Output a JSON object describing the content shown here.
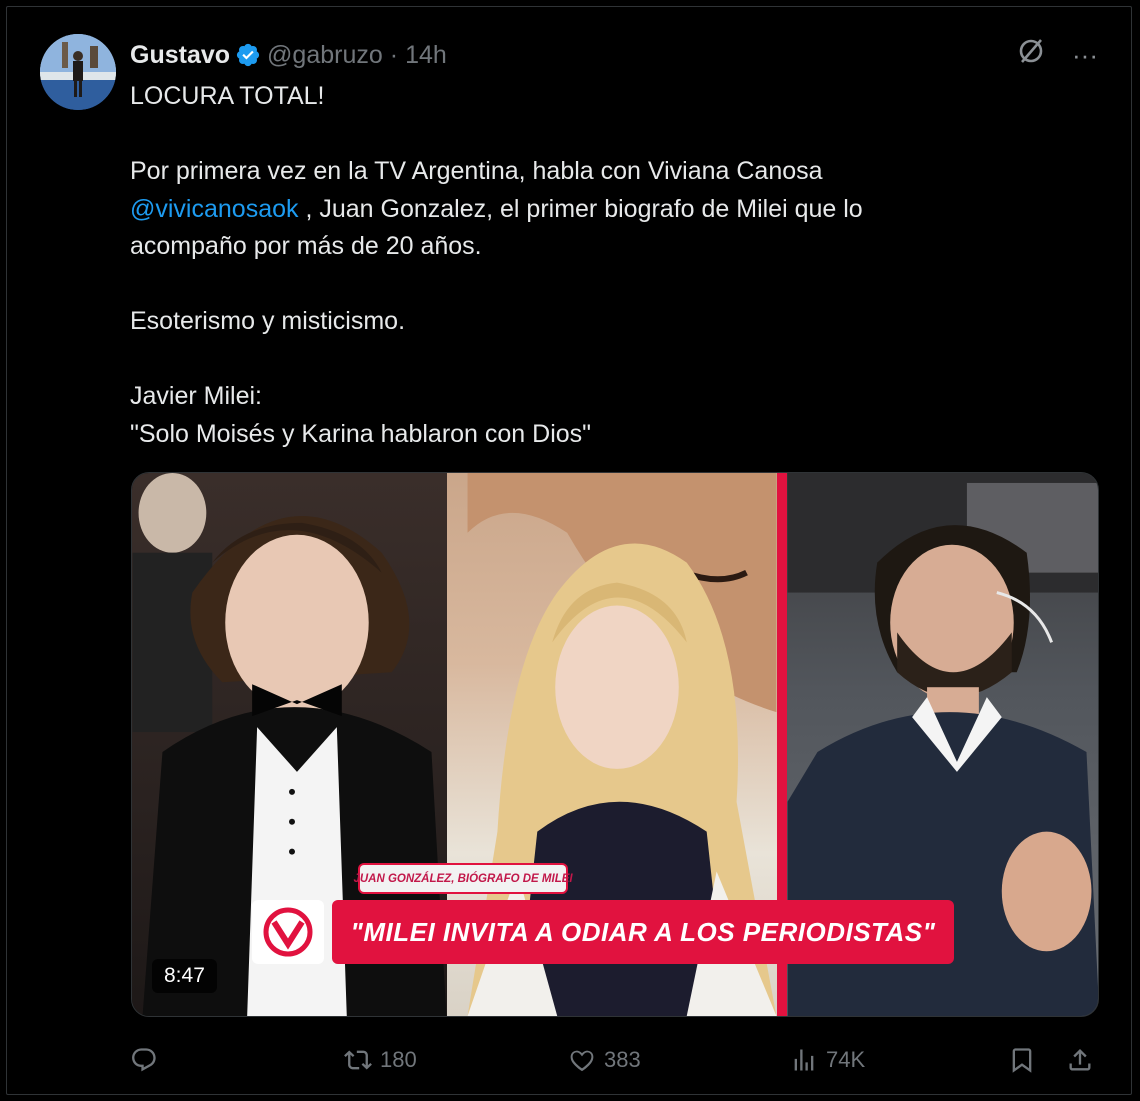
{
  "tweet": {
    "author_name": "Gustavo",
    "handle": "@gabruzo",
    "separator": "·",
    "time": "14h",
    "text_lines": [
      "LOCURA TOTAL!",
      "",
      "Por primera vez en la TV Argentina, habla con Viviana Canosa",
      "@vivicanosaok",
      " , Juan Gonzalez, el primer  biografo de Milei que lo",
      "acompaño por más de 20 años.",
      "",
      "Esoterismo y misticismo.",
      "",
      "Javier Milei:",
      "\"Solo Moisés y Karina hablaron con Dios\""
    ]
  },
  "top_icons": {
    "grok": "grok-icon",
    "more": "···"
  },
  "media": {
    "caption_tag": "JUAN GONZÁLEZ, BIÓGRAFO DE MILEI",
    "headline": "\"MILEI INVITA A ODIAR A LOS PERIODISTAS\"",
    "duration": "8:47"
  },
  "actions": {
    "reply_count": "",
    "retweet_count": "180",
    "like_count": "383",
    "views_count": "74K"
  },
  "colors": {
    "background": "#000000",
    "text": "#e7e9ea",
    "secondary_text": "#71767b",
    "mention": "#1d9bf0",
    "verified": "#1d9bf0",
    "tv_red": "#e1123f"
  }
}
